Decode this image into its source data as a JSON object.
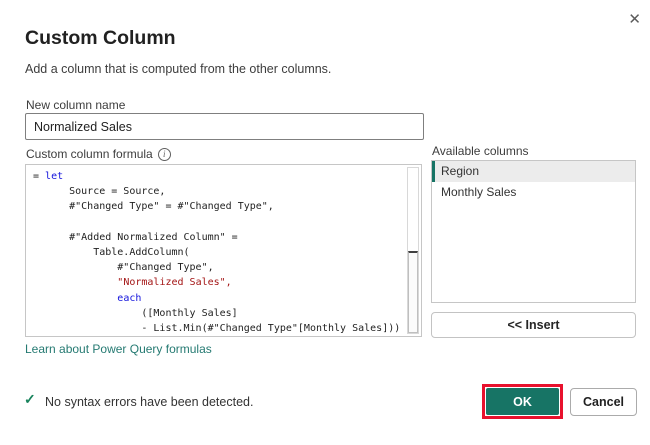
{
  "dialog": {
    "title": "Custom Column",
    "subtitle": "Add a column that is computed from the other columns.",
    "close_glyph": "✕"
  },
  "new_column": {
    "label": "New column name",
    "value": "Normalized Sales"
  },
  "formula": {
    "label": "Custom column formula",
    "info_glyph": "i",
    "link": "Learn about Power Query formulas",
    "code": [
      [
        [
          "= ",
          "p"
        ],
        [
          "let",
          "k"
        ]
      ],
      [
        [
          "      Source = Source,",
          "p"
        ]
      ],
      [
        [
          "      #\"Changed Type\" = #\"Changed Type\",",
          "p"
        ]
      ],
      [
        [
          "",
          "p"
        ]
      ],
      [
        [
          "      #\"Added Normalized Column\" =",
          "p"
        ]
      ],
      [
        [
          "          Table.AddColumn(",
          "p"
        ]
      ],
      [
        [
          "              #\"Changed Type\",",
          "p"
        ]
      ],
      [
        [
          "              ",
          "p"
        ],
        [
          "\"Normalized Sales\",",
          "s"
        ]
      ],
      [
        [
          "              ",
          "p"
        ],
        [
          "each",
          "k"
        ]
      ],
      [
        [
          "                  ([Monthly Sales]",
          "p"
        ]
      ],
      [
        [
          "                  - List.Min(#\"Changed Type\"[Monthly Sales]))",
          "p"
        ]
      ]
    ]
  },
  "available_columns": {
    "label": "Available columns",
    "items": [
      {
        "name": "Region",
        "selected": true
      },
      {
        "name": "Monthly Sales",
        "selected": false
      }
    ],
    "insert_label": "<< Insert"
  },
  "footer": {
    "status_glyph": "✓",
    "status": "No syntax errors have been detected.",
    "ok_label": "OK",
    "cancel_label": "Cancel"
  },
  "colors": {
    "accent_teal": "#177465",
    "keyword_blue": "#1414DC",
    "string_red": "#A31515",
    "link_teal": "#257A72",
    "annotation_red": "#E8112D",
    "check_green": "#18835C"
  }
}
